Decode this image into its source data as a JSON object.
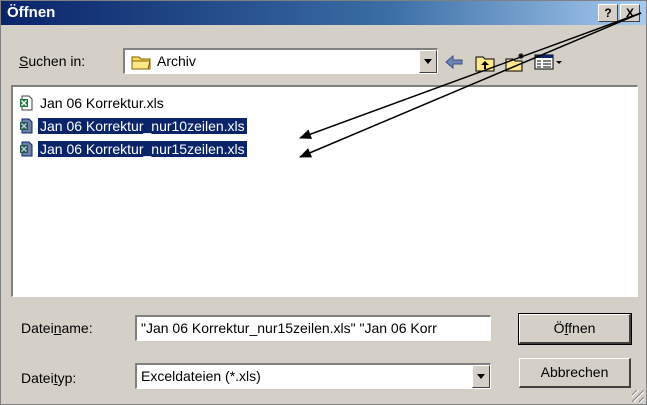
{
  "window": {
    "title": "Öffnen",
    "help_label": "?",
    "close_label": "X"
  },
  "lookin": {
    "label_pre": "",
    "label_accel": "S",
    "label_post": "uchen in:",
    "folder": "Archiv"
  },
  "toolbar": {
    "icons": [
      "back-arrow-icon",
      "up-folder-icon",
      "new-folder-icon",
      "view-menu-icon"
    ]
  },
  "files": [
    {
      "name": "Jan 06 Korrektur.xls",
      "selected": false
    },
    {
      "name": "Jan 06 Korrektur_nur10zeilen.xls",
      "selected": true
    },
    {
      "name": "Jan 06 Korrektur_nur15zeilen.xls",
      "selected": true
    }
  ],
  "filename": {
    "label_pre": "Datei",
    "label_accel": "n",
    "label_post": "ame:",
    "value": "\"Jan 06 Korrektur_nur15zeilen.xls\" \"Jan 06 Korr"
  },
  "filetype": {
    "label_pre": "Datei",
    "label_accel": "t",
    "label_post": "yp:",
    "value": "Exceldateien (*.xls)"
  },
  "buttons": {
    "open_pre": "Ö",
    "open_accel": "f",
    "open_post": "fnen",
    "cancel": "Abbrechen"
  },
  "colors": {
    "titlebar": "#0a246a",
    "selection": "#0a246a",
    "face": "#d4d0c8"
  }
}
